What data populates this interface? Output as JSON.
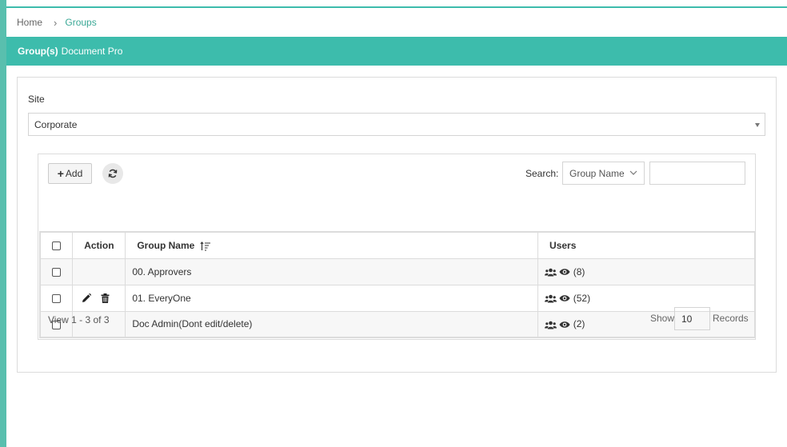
{
  "breadcrumb": {
    "home": "Home",
    "separator": "›",
    "current": "Groups"
  },
  "title_bar": {
    "bold": "Group(s)",
    "rest": "Document Pro"
  },
  "site": {
    "label": "Site",
    "selected": "Corporate"
  },
  "toolbar": {
    "add_label": "Add",
    "search_label": "Search:",
    "search_field": "Group Name",
    "search_value": ""
  },
  "table": {
    "headers": {
      "action": "Action",
      "group_name": "Group Name",
      "users": "Users"
    },
    "rows": [
      {
        "name": "00. Approvers",
        "users": "(8)",
        "editable": false
      },
      {
        "name": "01. EveryOne",
        "users": "(52)",
        "editable": true
      },
      {
        "name": "Doc Admin(Dont edit/delete)",
        "users": "(2)",
        "editable": false
      }
    ]
  },
  "footer": {
    "view_info": "View 1 - 3 of 3",
    "show_label": "Show",
    "page_size": "10",
    "records_label": "Records"
  },
  "colors": {
    "accent": "#3dbcac",
    "stripe": "#59bfae",
    "link": "#3aa896"
  },
  "icons": [
    "plus-icon",
    "refresh-icon",
    "sort-icon",
    "chevron-down-icon",
    "edit-icon",
    "trash-icon",
    "users-icon",
    "eye-icon"
  ]
}
